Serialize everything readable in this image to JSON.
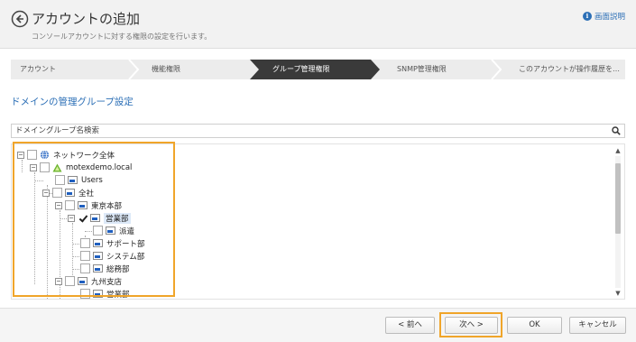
{
  "header": {
    "title": "アカウントの追加",
    "subtitle": "コンソールアカウントに対する権限の設定を行います。",
    "help_label": "画面説明",
    "help_icon": "info-icon"
  },
  "steps": [
    {
      "label": "アカウント",
      "active": false
    },
    {
      "label": "機能権限",
      "active": false
    },
    {
      "label": "グループ管理権限",
      "active": true
    },
    {
      "label": "SNMP管理権限",
      "active": false
    },
    {
      "label": "このアカウントが操作履歴を…",
      "active": false
    }
  ],
  "section_title": "ドメインの管理グループ設定",
  "search": {
    "placeholder": "ドメイングループ名検索",
    "value": ""
  },
  "tree": [
    {
      "label": "ネットワーク全体",
      "icon": "globe-icon",
      "checked": false
    },
    {
      "label": "motexdemo.local",
      "icon": "domain-icon",
      "checked": false
    },
    {
      "label": "Users",
      "icon": "folder-icon",
      "checked": false
    },
    {
      "label": "全社",
      "icon": "folder-icon",
      "checked": false
    },
    {
      "label": "東京本部",
      "icon": "folder-icon",
      "checked": false
    },
    {
      "label": "営業部",
      "icon": "folder-icon",
      "checked": true
    },
    {
      "label": "派遣",
      "icon": "folder-icon",
      "checked": false
    },
    {
      "label": "サポート部",
      "icon": "folder-icon",
      "checked": false
    },
    {
      "label": "システム部",
      "icon": "folder-icon",
      "checked": false
    },
    {
      "label": "総務部",
      "icon": "folder-icon",
      "checked": false
    },
    {
      "label": "九州支店",
      "icon": "folder-icon",
      "checked": false
    },
    {
      "label": "営業部",
      "icon": "folder-icon",
      "checked": false
    }
  ],
  "buttons": {
    "prev": "< 前へ",
    "next": "次へ >",
    "ok": "OK",
    "cancel": "キャンセル"
  },
  "colors": {
    "accent": "#2c6fb6",
    "highlight": "#f0a52a",
    "active_step": "#3a3a3a"
  }
}
